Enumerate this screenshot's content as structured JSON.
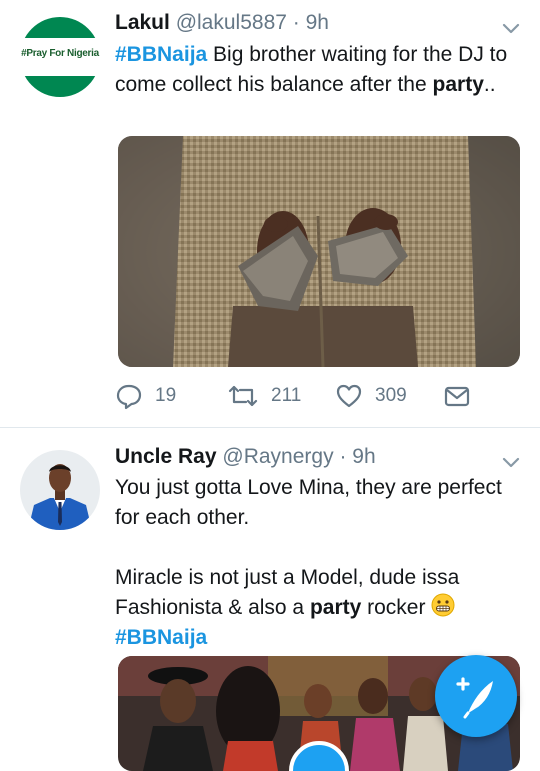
{
  "tweets": [
    {
      "name": "Lakul",
      "handle": "@lakul5887",
      "separator": "·",
      "time": "9h",
      "avatar_text": "#Pray For Nigeria",
      "text": {
        "hashtag": "#BBNaija",
        "body": " Big brother waiting for the DJ to come collect his balance after the ",
        "highlight": "party",
        "end": ".."
      },
      "stats": {
        "replies": "19",
        "retweets": "211",
        "likes": "309"
      }
    },
    {
      "name": "Uncle Ray",
      "handle": "@Raynergy",
      "separator": "·",
      "time": "9h",
      "text": {
        "line1": "You just gotta Love Mina, they are perfect for each other.",
        "line2_start": "Miracle is not just a Model, dude issa Fashionista & also a ",
        "highlight": "party",
        "line2_end": " rocker ",
        "hashtag": "#BBNaija"
      }
    }
  ],
  "icons": {
    "reply": "reply-icon",
    "retweet": "retweet-icon",
    "like": "heart-icon",
    "dm": "envelope-icon",
    "caret": "chevron-down-icon",
    "compose": "compose-tweet-icon"
  },
  "colors": {
    "link": "#1b95e0",
    "secondary_text": "#657786",
    "fab": "#1da1f2",
    "nigeria_green": "#008751"
  }
}
